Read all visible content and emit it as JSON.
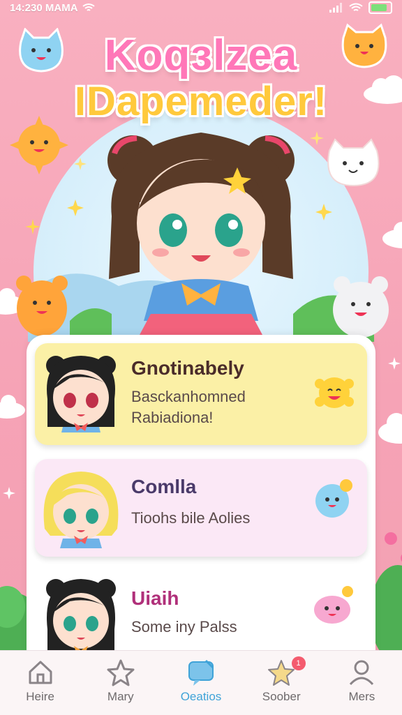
{
  "status": {
    "time": "14:230 MAMA"
  },
  "title": {
    "line1": "Koqзlzea",
    "line2": "IDapemeder!"
  },
  "colors": {
    "accent": "#3fa3d8",
    "card1": "#fbf0a6",
    "card2": "#fbe8f6",
    "card3": "#ffffff"
  },
  "cards": [
    {
      "name": "Gnotinabely",
      "sub1": "Basckanhomned",
      "sub2": "Rabiadiona!",
      "name_color": "#4a2c2a",
      "mini": "sun-smiley-icon"
    },
    {
      "name": "Comlla",
      "sub1": "Tioohs bile Aolies",
      "sub2": "",
      "name_color": "#4a3a6a",
      "mini": "blue-bubble-icon"
    },
    {
      "name": "Uiaih",
      "sub1": "Some iny Palss",
      "sub2": "",
      "name_color": "#b0307a",
      "mini": "pink-blob-icon"
    }
  ],
  "tabs": [
    {
      "label": "Heire",
      "icon": "home-icon"
    },
    {
      "label": "Mary",
      "icon": "star-icon"
    },
    {
      "label": "Oeatios",
      "icon": "chat-icon",
      "active": true
    },
    {
      "label": "Soober",
      "icon": "star-badge-icon",
      "badge": "1"
    },
    {
      "label": "Mers",
      "icon": "profile-icon"
    }
  ]
}
